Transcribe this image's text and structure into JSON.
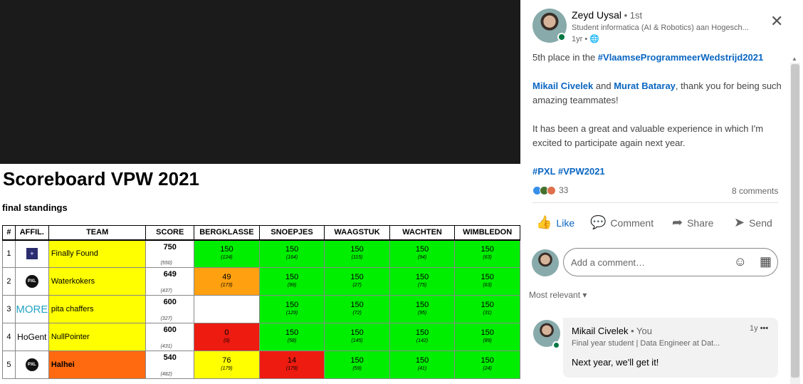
{
  "scoreboard": {
    "title": "Scoreboard VPW 2021",
    "subtitle": "final standings",
    "headers": [
      "#",
      "AFFIL.",
      "TEAM",
      "SCORE",
      "BERGKLASSE",
      "SNOEPJES",
      "WAAGSTUK",
      "WACHTEN",
      "WIMBLEDON"
    ],
    "rows": [
      {
        "rank": "1",
        "affil": "star-logo",
        "team": "Finally Found",
        "score": "750",
        "score_sub": "(550)",
        "cells": [
          {
            "v": "150",
            "s": "(124)",
            "c": "green"
          },
          {
            "v": "150",
            "s": "(164)",
            "c": "green"
          },
          {
            "v": "150",
            "s": "(115)",
            "c": "green"
          },
          {
            "v": "150",
            "s": "(94)",
            "c": "green"
          },
          {
            "v": "150",
            "s": "(63)",
            "c": "green"
          }
        ]
      },
      {
        "rank": "2",
        "affil": "PXL",
        "team": "Waterkokers",
        "score": "649",
        "score_sub": "(437)",
        "cells": [
          {
            "v": "49",
            "s": "(173)",
            "c": "orange"
          },
          {
            "v": "150",
            "s": "(99)",
            "c": "green"
          },
          {
            "v": "150",
            "s": "(27)",
            "c": "green"
          },
          {
            "v": "150",
            "s": "(75)",
            "c": "green"
          },
          {
            "v": "150",
            "s": "(63)",
            "c": "green"
          }
        ]
      },
      {
        "rank": "3",
        "affil": "MORE",
        "team": "pita chaffers",
        "score": "600",
        "score_sub": "(327)",
        "cells": [
          {
            "v": "",
            "s": "",
            "c": "white"
          },
          {
            "v": "150",
            "s": "(129)",
            "c": "green"
          },
          {
            "v": "150",
            "s": "(72)",
            "c": "green"
          },
          {
            "v": "150",
            "s": "(95)",
            "c": "green"
          },
          {
            "v": "150",
            "s": "(31)",
            "c": "green"
          }
        ]
      },
      {
        "rank": "4",
        "affil": "HoGent",
        "team": "NullPointer",
        "score": "600",
        "score_sub": "(431)",
        "cells": [
          {
            "v": "0",
            "s": "(0)",
            "c": "red"
          },
          {
            "v": "150",
            "s": "(58)",
            "c": "green"
          },
          {
            "v": "150",
            "s": "(145)",
            "c": "green"
          },
          {
            "v": "150",
            "s": "(142)",
            "c": "green"
          },
          {
            "v": "150",
            "s": "(89)",
            "c": "green"
          }
        ]
      },
      {
        "rank": "5",
        "affil": "PXL",
        "team": "Halhei",
        "score": "540",
        "score_sub": "(482)",
        "cells": [
          {
            "v": "76",
            "s": "(179)",
            "c": "yellow"
          },
          {
            "v": "14",
            "s": "(179)",
            "c": "red"
          },
          {
            "v": "150",
            "s": "(59)",
            "c": "green"
          },
          {
            "v": "150",
            "s": "(41)",
            "c": "green"
          },
          {
            "v": "150",
            "s": "(24)",
            "c": "green"
          }
        ]
      }
    ]
  },
  "post": {
    "author": "Zeyd Uysal",
    "degree": " • 1st",
    "headline": "Student informatica (AI & Robotics) aan Hogesch...",
    "timestamp": "1yr •",
    "hashtag_line_prefix": "5th place in the ",
    "hashtag_main": "#VlaamseProgrammeerWedstrijd2021",
    "mention1": "Mikail Civelek",
    "and_text": " and ",
    "mention2": "Murat Bataray",
    "thanks_text": ", thank you for being such amazing teammates!",
    "body": "It has been a great and valuable experience in which I'm excited to participate again next year.",
    "tags": "#PXL #VPW2021",
    "reaction_count": "33",
    "comments_count": "8 comments"
  },
  "actions": {
    "like": "Like",
    "comment": "Comment",
    "share": "Share",
    "send": "Send"
  },
  "comment_input": {
    "placeholder": "Add a comment…"
  },
  "sort": {
    "label": "Most relevant"
  },
  "comment": {
    "author": "Mikail Civelek",
    "you": " • You",
    "headline": "Final year student | Data Engineer at Dat...",
    "time": "1y",
    "text": "Next year, we'll get it!"
  },
  "colors": {
    "green": "#00ee00",
    "orange": "#ffa010",
    "red": "#ee1b10",
    "yellow": "#ffff00",
    "link": "#0a66c2"
  }
}
